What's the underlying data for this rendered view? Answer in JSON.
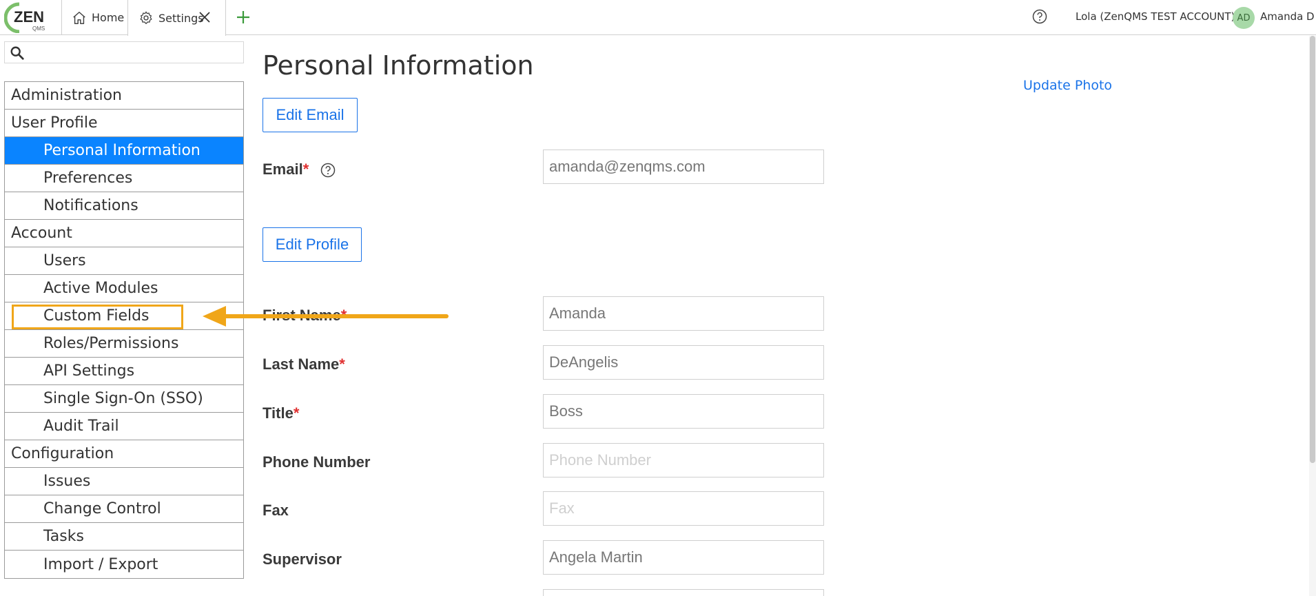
{
  "topbar": {
    "logo_text": "ZEN",
    "logo_sub": "QMS",
    "tabs": [
      {
        "label": "Home"
      },
      {
        "label": "Settings"
      }
    ],
    "account_label": "Lola (ZenQMS TEST ACCOUNT)",
    "avatar_initials": "AD",
    "user_name": "Amanda D"
  },
  "sidebar": {
    "search_placeholder": "",
    "items": [
      {
        "label": "Administration",
        "level": 1
      },
      {
        "label": "User Profile",
        "level": 1
      },
      {
        "label": "Personal Information",
        "level": 2,
        "active": true
      },
      {
        "label": "Preferences",
        "level": 2
      },
      {
        "label": "Notifications",
        "level": 2
      },
      {
        "label": "Account",
        "level": 1
      },
      {
        "label": "Users",
        "level": 2
      },
      {
        "label": "Active Modules",
        "level": 2
      },
      {
        "label": "Custom Fields",
        "level": 2,
        "highlighted": true
      },
      {
        "label": "Roles/Permissions",
        "level": 2
      },
      {
        "label": "API Settings",
        "level": 2
      },
      {
        "label": "Single Sign-On (SSO)",
        "level": 2
      },
      {
        "label": "Audit Trail",
        "level": 2
      },
      {
        "label": "Configuration",
        "level": 1
      },
      {
        "label": "Issues",
        "level": 2
      },
      {
        "label": "Change Control",
        "level": 2
      },
      {
        "label": "Tasks",
        "level": 2
      },
      {
        "label": "Import / Export",
        "level": 2
      }
    ]
  },
  "main": {
    "title": "Personal Information",
    "update_photo": "Update Photo",
    "edit_email_label": "Edit Email",
    "edit_profile_label": "Edit Profile",
    "email": {
      "label": "Email",
      "value": "amanda@zenqms.com"
    },
    "first_name": {
      "label": "First Name",
      "value": "Amanda"
    },
    "last_name": {
      "label": "Last Name",
      "value": "DeAngelis"
    },
    "title_field": {
      "label": "Title",
      "value": "Boss"
    },
    "phone": {
      "label": "Phone Number",
      "placeholder": "Phone Number"
    },
    "fax": {
      "label": "Fax",
      "placeholder": "Fax"
    },
    "supervisor": {
      "label": "Supervisor",
      "value": "Angela Martin"
    },
    "required_mark": "*"
  },
  "colors": {
    "accent": "#0a84ff",
    "link": "#1a73e8",
    "highlight": "#f0a619",
    "required": "#e03030",
    "plus_green": "#3a9a3a"
  }
}
